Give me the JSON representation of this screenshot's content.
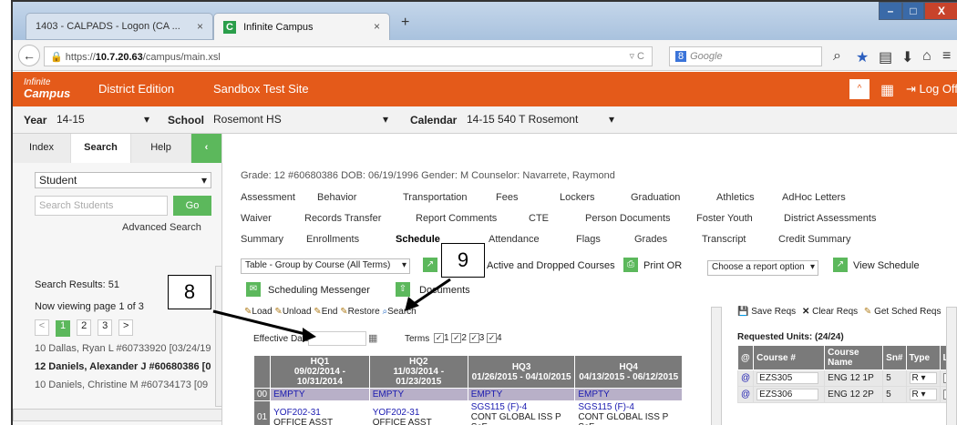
{
  "browser": {
    "tabs": [
      {
        "label": "1403 - CALPADS - Logon (CA ...",
        "close": "×"
      },
      {
        "label": "Infinite Campus",
        "close": "×",
        "favicon": "C"
      }
    ],
    "new_tab": "+",
    "url_prefix": "https://",
    "url_host": "10.7.20.63",
    "url_path": "/campus/main.xsl",
    "search_placeholder": "Google",
    "window_buttons": [
      "–",
      "□",
      "X"
    ]
  },
  "appbar": {
    "logo_line1": "Infinite",
    "logo_line2": "Campus",
    "edition": "District Edition",
    "site": "Sandbox Test Site",
    "logoff": "Log Off",
    "accent_color": "#e45a1a"
  },
  "context": {
    "year_label": "Year",
    "year_value": "14-15",
    "school_label": "School",
    "school_value": "Rosemont HS",
    "calendar_label": "Calendar",
    "calendar_value": "14-15 540 T Rosemont"
  },
  "left": {
    "tabs": [
      "Index",
      "Search",
      "Help"
    ],
    "collapse": "‹",
    "search_type": "Student",
    "search_placeholder": "Search Students",
    "go": "Go",
    "advanced": "Advanced Search",
    "results": "Search Results: 51",
    "viewing": "Now viewing page 1 of 3",
    "pages": [
      "<",
      "1",
      "2",
      "3",
      ">"
    ],
    "students": [
      "10 Dallas, Ryan L #60733920 [03/24/19",
      "12 Daniels, Alexander J #60680386 [0",
      "10 Daniels, Christine M #60734173 [09/"
    ]
  },
  "student": {
    "info": "Grade: 12   #60680386   DOB: 06/19/1996   Gender: M   Counselor: Navarrete, Raymond"
  },
  "tabs_row1": [
    "Assessment",
    "Behavior",
    "Transportation",
    "Fees",
    "Lockers",
    "Graduation",
    "Athletics",
    "AdHoc Letters"
  ],
  "tabs_row2": [
    "Waiver",
    "Records Transfer",
    "Report Comments",
    "CTE",
    "Person Documents",
    "Foster Youth",
    "District Assessments"
  ],
  "tabs_row3": [
    "Summary",
    "Enrollments",
    "Schedule",
    "Attendance",
    "Flags",
    "Grades",
    "Transcript",
    "Credit Summary"
  ],
  "toolbar": {
    "view_select": "Table - Group by Course (All Terms)",
    "active_dropped": "Active and Dropped Courses",
    "print": "Print OR",
    "report_select": "Choose a report option",
    "view_schedule": "View Schedule",
    "messenger": "Scheduling Messenger",
    "documents": "Documents",
    "actions": [
      "Load",
      "Unload",
      "End",
      "Restore",
      "Search"
    ]
  },
  "grid": {
    "effective_label": "Effective Date",
    "terms_label": "Terms",
    "terms": [
      "1",
      "2",
      "3",
      "4"
    ],
    "headers": [
      {
        "name": "HQ1",
        "dates": "09/02/2014 - 10/31/2014"
      },
      {
        "name": "HQ2",
        "dates": "11/03/2014 - 01/23/2015"
      },
      {
        "name": "HQ3",
        "dates": "01/26/2015 - 04/10/2015"
      },
      {
        "name": "HQ4",
        "dates": "04/13/2015 - 06/12/2015"
      }
    ],
    "rows": [
      {
        "period": "00",
        "cells": [
          {
            "c": "EMPTY",
            "d": ""
          },
          {
            "c": "EMPTY",
            "d": ""
          },
          {
            "c": "EMPTY",
            "d": ""
          },
          {
            "c": "EMPTY",
            "d": ""
          }
        ]
      },
      {
        "period": "01",
        "cells": [
          {
            "c": "YOF202-31",
            "d": "OFFICE ASST"
          },
          {
            "c": "YOF202-31",
            "d": "OFFICE ASST"
          },
          {
            "c": "SGS115 (F)-4",
            "d": "CONT GLOBAL ISS P ScF"
          },
          {
            "c": "SGS115 (F)-4",
            "d": "CONT GLOBAL ISS P ScF"
          }
        ]
      }
    ]
  },
  "requests": {
    "actions": [
      "Save Reqs",
      "Clear Reqs",
      "Get Sched Reqs"
    ],
    "units": "Requested Units: (24/24)",
    "headers": [
      "@",
      "Course #",
      "Course Name",
      "Sn#",
      "Type",
      "Lo"
    ],
    "rows": [
      {
        "at": "@",
        "course": "EZS305",
        "name": "ENG 12 1P",
        "sn": "5",
        "type": "R"
      },
      {
        "at": "@",
        "course": "EZS306",
        "name": "ENG 12 2P",
        "sn": "5",
        "type": "R"
      }
    ]
  },
  "callouts": [
    "8",
    "9"
  ]
}
